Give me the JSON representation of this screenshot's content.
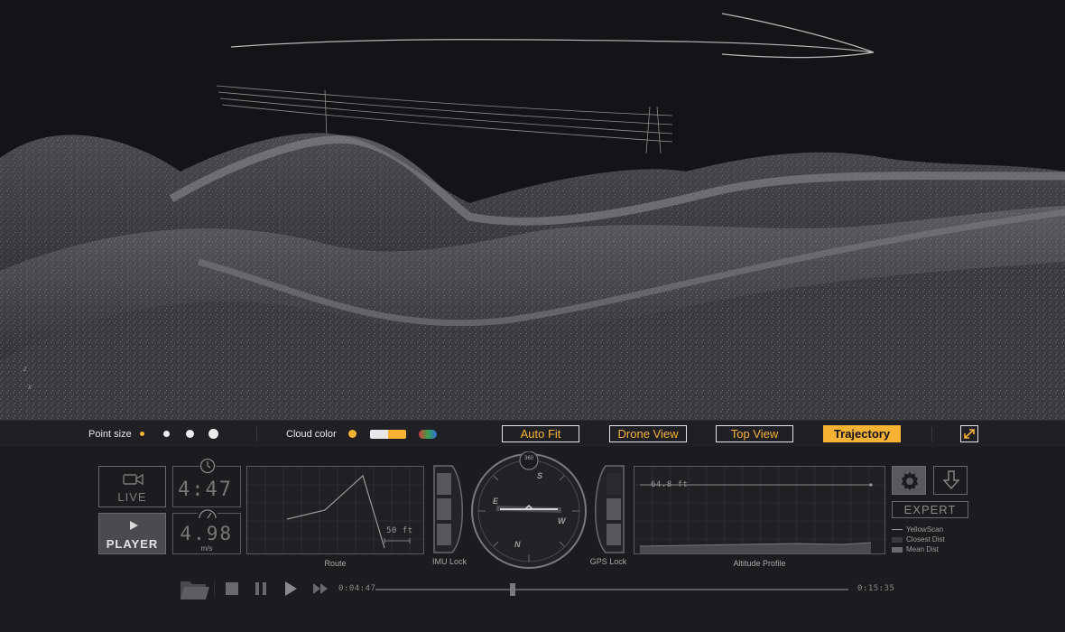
{
  "viewport": {
    "axis_labels": [
      "z",
      "x"
    ]
  },
  "toolbar": {
    "point_size_label": "Point size",
    "cloud_color_label": "Cloud color",
    "view_buttons": [
      {
        "label": "Auto Fit",
        "active": false
      },
      {
        "label": "Drone View",
        "active": false
      },
      {
        "label": "Top View",
        "active": false
      },
      {
        "label": "Trajectory",
        "active": true
      }
    ],
    "accent_color": "#f6b233",
    "fullscreen_icon": "expand-icon"
  },
  "dashboard": {
    "live_label": "LIVE",
    "player_label": "PLAYER",
    "time_value": "4:47",
    "speed_value": "4.98",
    "speed_unit": "m/s",
    "route": {
      "caption": "Route",
      "scale_label": "50 ft"
    },
    "imu": {
      "caption": "IMU Lock"
    },
    "compass": {
      "top_marker": "360",
      "letters": [
        "S",
        "E",
        "W",
        "N"
      ]
    },
    "gps": {
      "caption": "GPS Lock"
    },
    "altitude": {
      "caption": "Altitude Profile",
      "value_label": "64.8 ft"
    },
    "expert_label": "EXPERT",
    "legend": [
      "YellowScan",
      "Closest Dist",
      "Mean Dist"
    ]
  },
  "player": {
    "current_time": "0:04:47",
    "end_time": "0:15:35",
    "progress": 0.29
  }
}
